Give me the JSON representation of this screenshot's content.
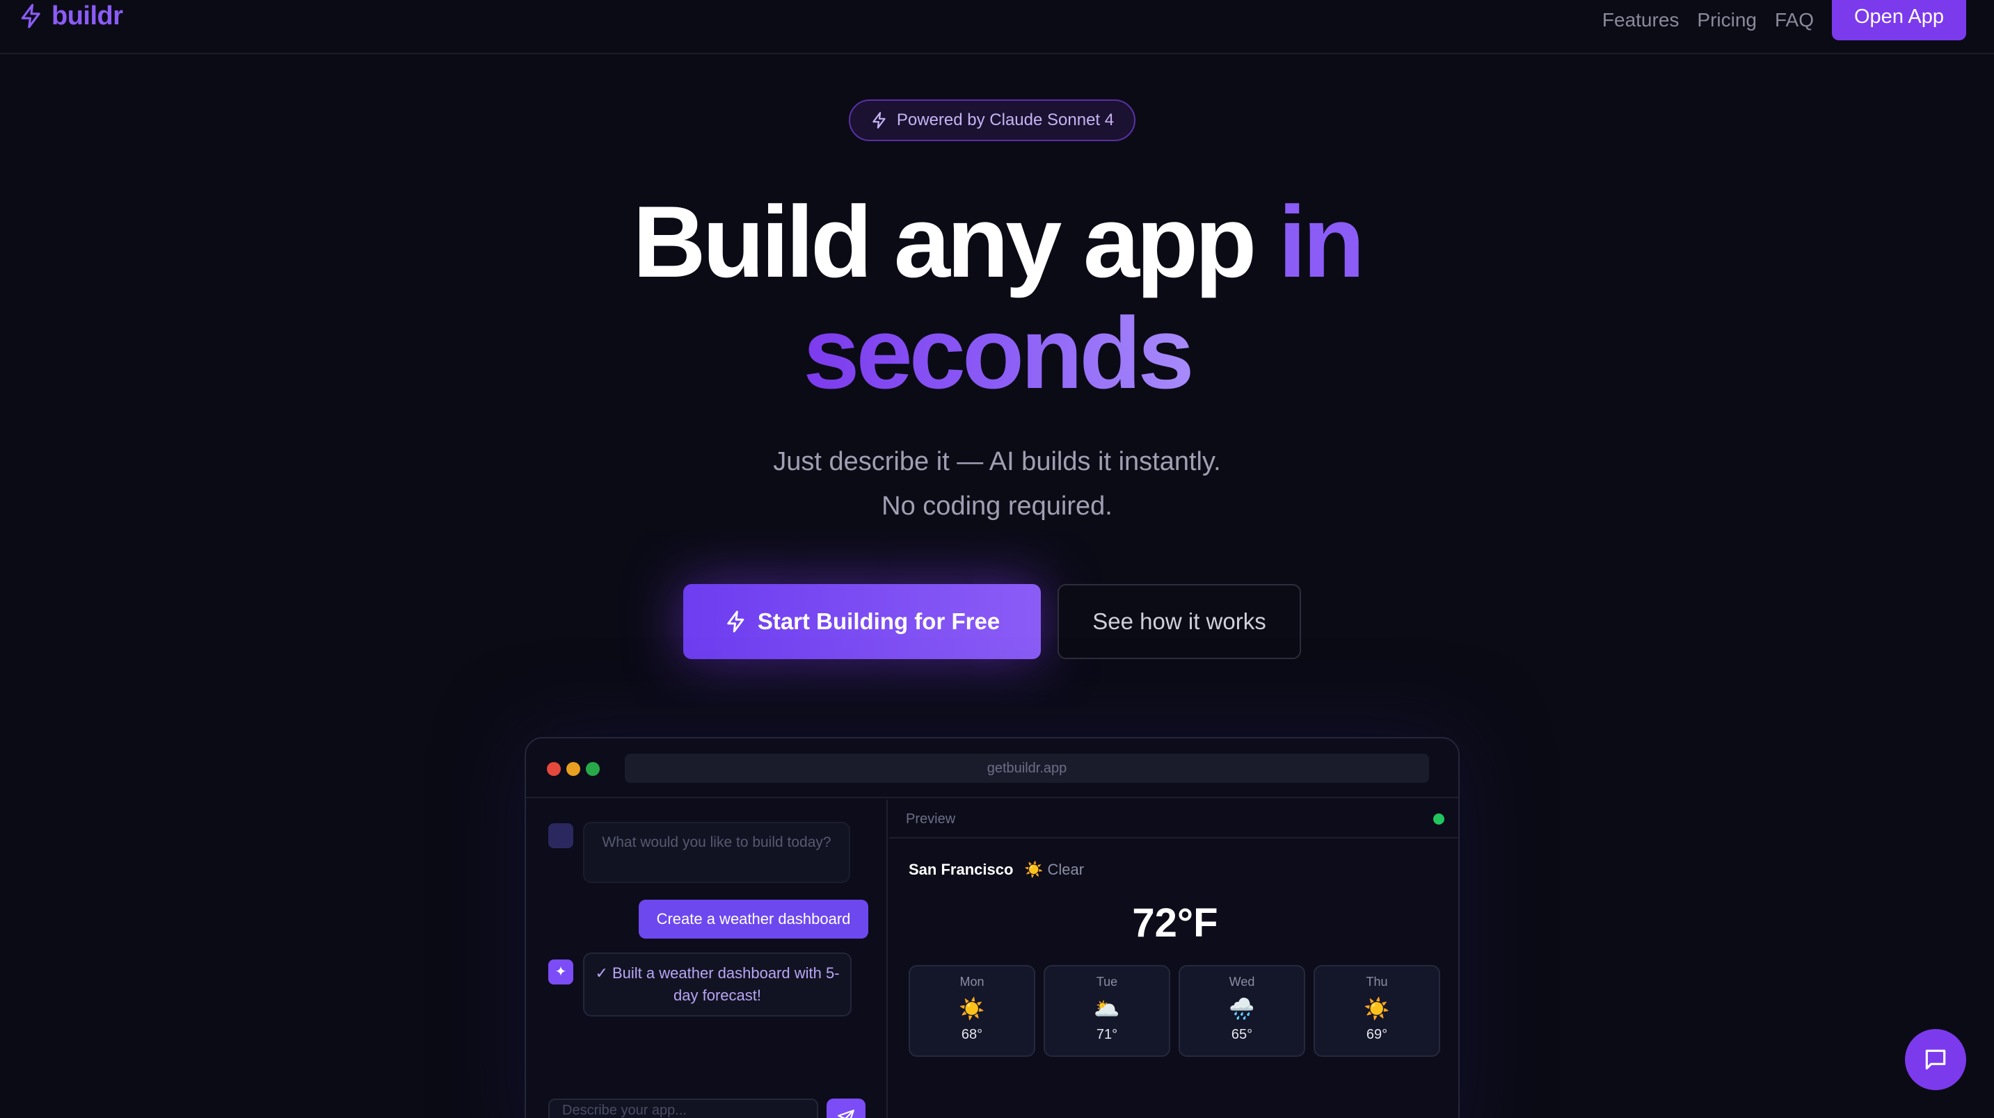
{
  "nav": {
    "brand": "buildr",
    "links": [
      "Features",
      "Pricing",
      "FAQ"
    ],
    "cta": "Open App"
  },
  "hero": {
    "badge": "Powered by Claude Sonnet 4",
    "headline_white": "Build any app",
    "headline_purple": "in",
    "headline_line2": "seconds",
    "subtitle_line1": "Just describe it — AI builds it instantly.",
    "subtitle_line2": "No coding required.",
    "primary_cta": "Start Building for Free",
    "secondary_cta": "See how it works"
  },
  "preview_window": {
    "url": "getbuildr.app",
    "chat": {
      "prompt_placeholder": "What would you like to build today?",
      "user_message": "Create a weather dashboard",
      "ai_avatar": "✦",
      "ai_message": "✓ Built a weather dashboard with 5-day forecast!",
      "input_placeholder": "Describe your app..."
    },
    "preview": {
      "label": "Preview",
      "status_color": "#22c55e",
      "city": "San Francisco",
      "condition": "☀️ Clear",
      "temperature": "72°F",
      "forecast": [
        {
          "day": "Mon",
          "icon": "☀️",
          "temp": "68°"
        },
        {
          "day": "Tue",
          "icon": "🌥️",
          "temp": "71°"
        },
        {
          "day": "Wed",
          "icon": "🌧️",
          "temp": "65°"
        },
        {
          "day": "Thu",
          "icon": "☀️",
          "temp": "69°"
        }
      ]
    }
  },
  "colors": {
    "background": "#0b0b16",
    "accent": "#7c3aed",
    "accent_light": "#8b5cf6"
  }
}
